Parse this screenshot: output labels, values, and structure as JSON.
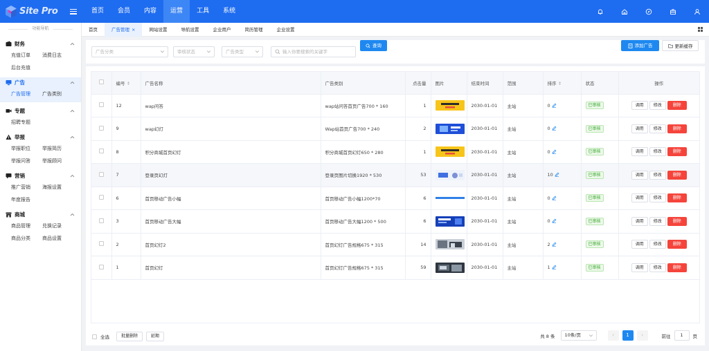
{
  "brand": {
    "name": "Site Pro"
  },
  "topnav": [
    {
      "label": "首页",
      "active": false
    },
    {
      "label": "会员",
      "active": false
    },
    {
      "label": "内容",
      "active": false
    },
    {
      "label": "运营",
      "active": true
    },
    {
      "label": "工具",
      "active": false
    },
    {
      "label": "系统",
      "active": false
    }
  ],
  "top_icons": [
    "bell-icon",
    "home-icon",
    "compass-icon",
    "briefcase-icon",
    "user-icon"
  ],
  "sidebar": {
    "title": "功能导航",
    "groups": [
      {
        "label": "财务",
        "icon": "wallet-icon",
        "items": [
          "充值订单",
          "消费日志",
          "后台充值"
        ]
      },
      {
        "label": "广告",
        "icon": "monitor-icon",
        "items": [
          "广告管理",
          "广告类别"
        ],
        "active": true,
        "active_item": "广告管理"
      },
      {
        "label": "专题",
        "icon": "video-icon",
        "items": [
          "招聘专题"
        ]
      },
      {
        "label": "举报",
        "icon": "warning-icon",
        "items": [
          "举报职位",
          "举报简历",
          "举报问答",
          "举报顾问"
        ]
      },
      {
        "label": "营销",
        "icon": "chat-icon",
        "items": [
          "推广营销",
          "海报设置",
          "年度报告"
        ]
      },
      {
        "label": "商城",
        "icon": "shop-icon",
        "items": [
          "商品管理",
          "兑换记录",
          "商品分类",
          "商品设置"
        ]
      }
    ]
  },
  "tabs": [
    {
      "label": "首页",
      "active": false
    },
    {
      "label": "广告管理",
      "active": true,
      "closable": true
    },
    {
      "label": "网站设置",
      "active": false
    },
    {
      "label": "导航设置",
      "active": false
    },
    {
      "label": "企业用户",
      "active": false
    },
    {
      "label": "简历管理",
      "active": false
    },
    {
      "label": "企业设置",
      "active": false
    }
  ],
  "filters": {
    "category_placeholder": "广告分类",
    "status_placeholder": "审核状态",
    "type_placeholder": "广告类型",
    "search_placeholder": "输入你要搜索的关键字",
    "search_label": "查询",
    "add_label": "添加广告",
    "refresh_label": "更新缓存"
  },
  "table": {
    "columns": [
      "编号",
      "广告名称",
      "广告类别",
      "点击量",
      "图片",
      "结束时间",
      "范围",
      "排序",
      "状态",
      "操作"
    ],
    "rows": [
      {
        "id": "12",
        "name": "wap问答",
        "category": "wap站问答首页广告700 * 160",
        "clicks": "1",
        "end": "2030-01-01",
        "scope": "主站",
        "sort": "0",
        "status": "已审核",
        "thumb": "yellow"
      },
      {
        "id": "9",
        "name": "wap幻灯",
        "category": "Wap站首页广告700 * 240",
        "clicks": "2",
        "end": "2030-01-01",
        "scope": "主站",
        "sort": "0",
        "status": "已审核",
        "thumb": "blue"
      },
      {
        "id": "8",
        "name": "积分商城首页幻灯",
        "category": "积分商城首页幻灯650 * 280",
        "clicks": "1",
        "end": "2030-01-01",
        "scope": "主站",
        "sort": "0",
        "status": "已审核",
        "thumb": "yellow"
      },
      {
        "id": "7",
        "name": "登录页幻灯",
        "category": "登录页图片切换1920 * 530",
        "clicks": "53",
        "end": "2030-01-01",
        "scope": "主站",
        "sort": "10",
        "status": "已审核",
        "thumb": "light"
      },
      {
        "id": "6",
        "name": "首页移动广告小幅",
        "category": "首页移动广告小幅1200*70",
        "clicks": "6",
        "end": "2030-01-01",
        "scope": "主站",
        "sort": "0",
        "status": "已审核",
        "thumb": "strip"
      },
      {
        "id": "3",
        "name": "首页移动广告大幅",
        "category": "首页移动广告大幅1200 * 500",
        "clicks": "6",
        "end": "2030-01-01",
        "scope": "主站",
        "sort": "0",
        "status": "已审核",
        "thumb": "navy"
      },
      {
        "id": "2",
        "name": "首页幻灯2",
        "category": "首页幻灯广告规格675 * 315",
        "clicks": "14",
        "end": "2030-01-01",
        "scope": "主站",
        "sort": "2",
        "status": "已审核",
        "thumb": "photo"
      },
      {
        "id": "1",
        "name": "首页幻灯",
        "category": "首页幻灯广告规格675 * 315",
        "clicks": "59",
        "end": "2030-01-01",
        "scope": "主站",
        "sort": "1",
        "status": "已审核",
        "thumb": "photo2"
      }
    ],
    "actions": {
      "use": "调用",
      "edit": "修改",
      "delete": "删除"
    }
  },
  "footer": {
    "select_all": "全选",
    "batch_delete": "批量删除",
    "extend": "延期",
    "total": "共 8 条",
    "page_size": "10条/页",
    "current_page": "1",
    "goto_label": "前往",
    "goto_value": "1",
    "page_unit": "页"
  },
  "colors": {
    "primary": "#1e6cf0",
    "button_blue": "#1e88f0",
    "danger": "#f5443b",
    "success": "#36a82a"
  }
}
